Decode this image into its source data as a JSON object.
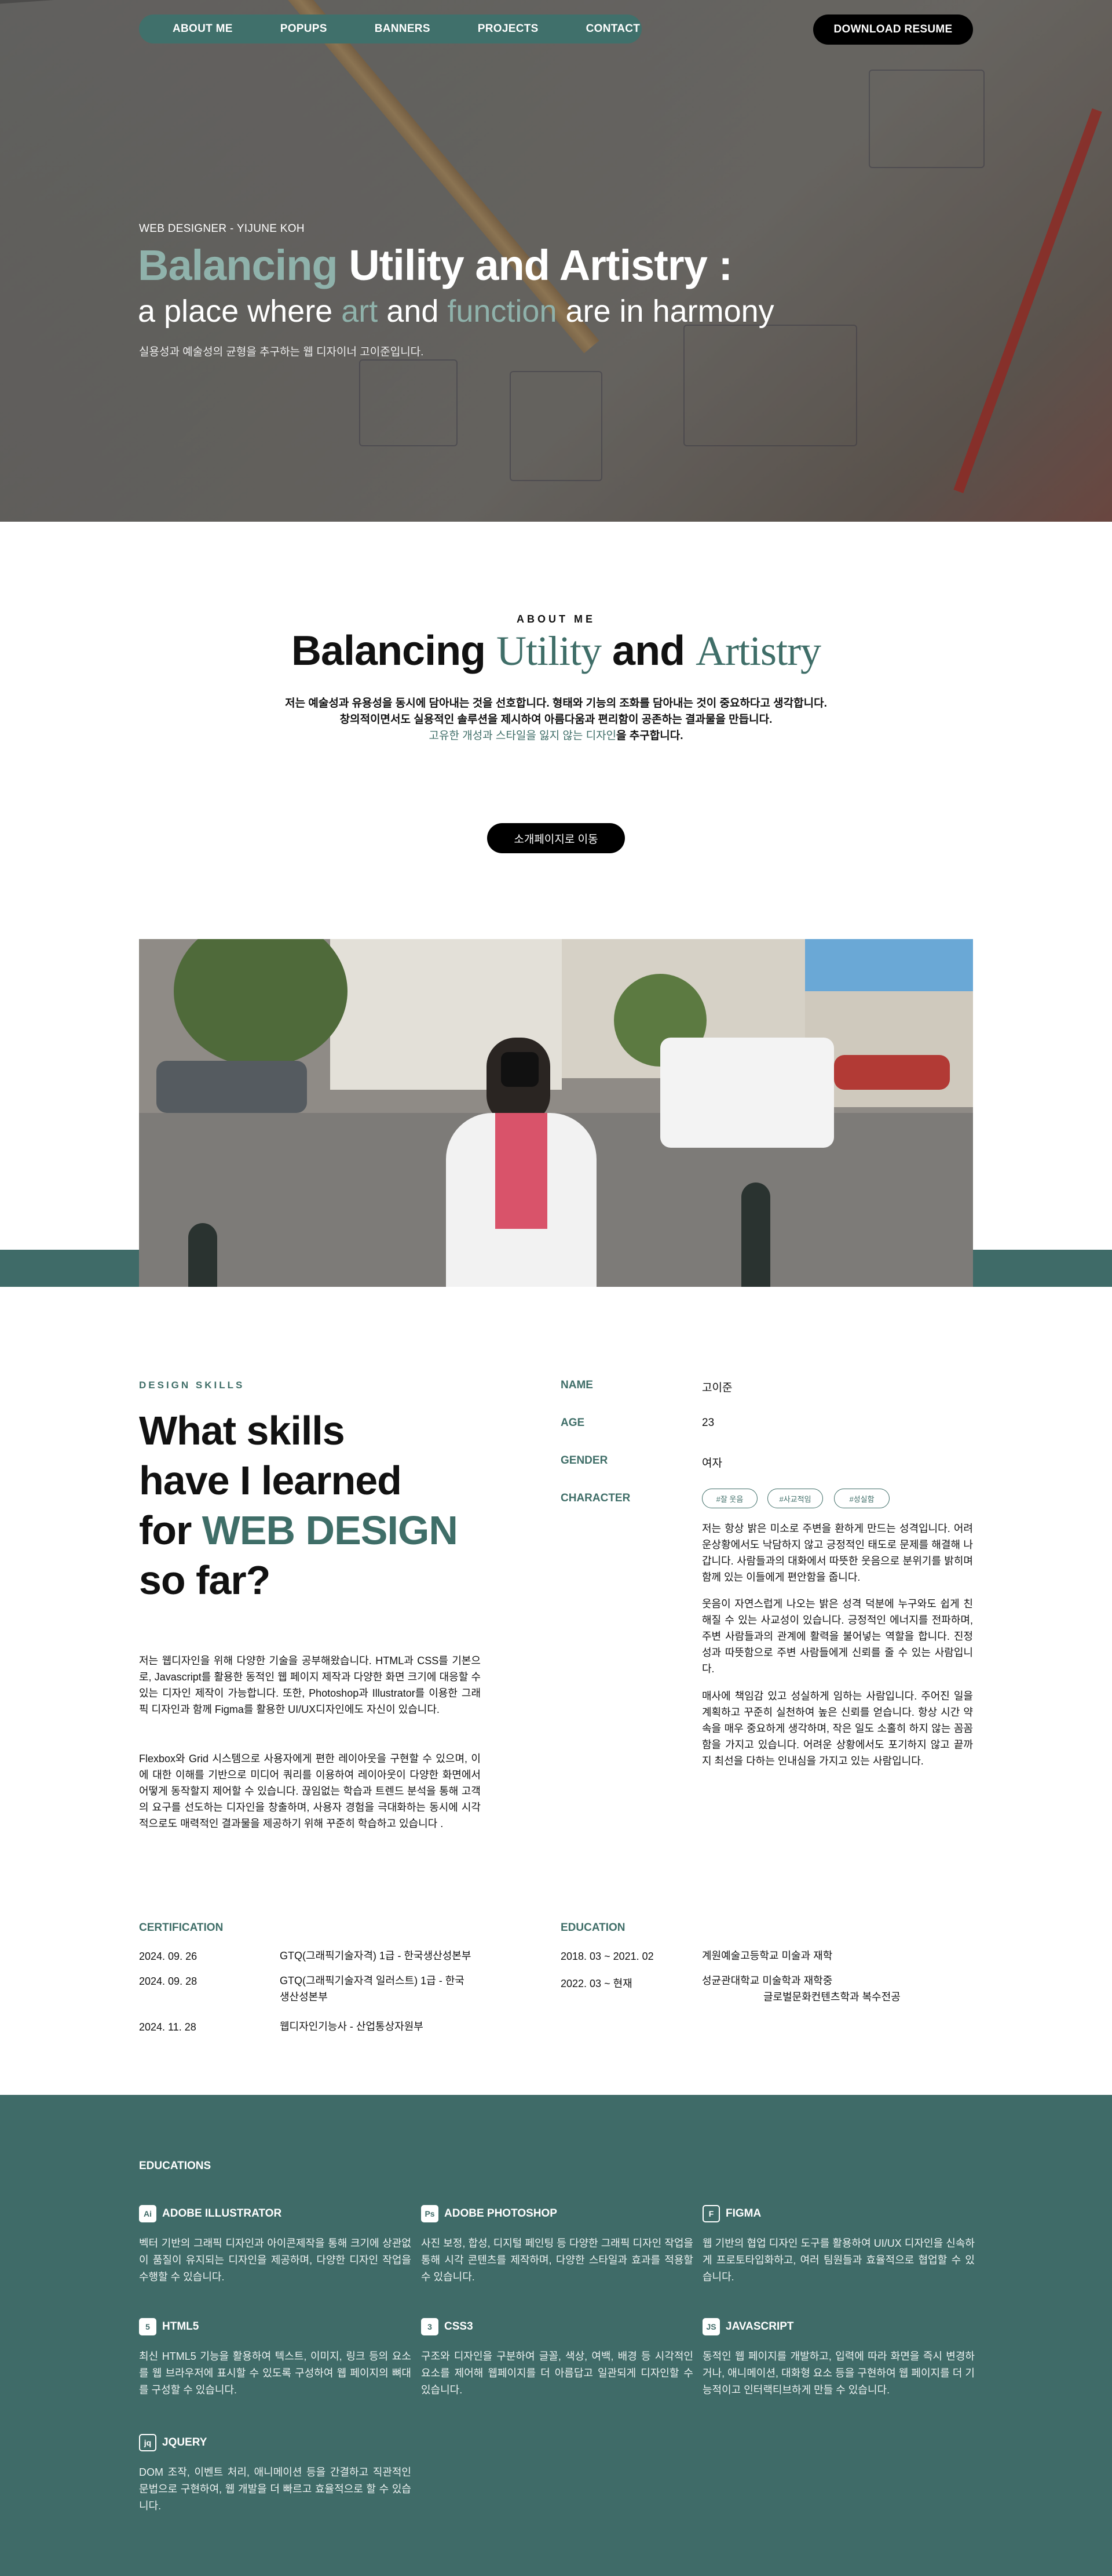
{
  "nav": {
    "items": [
      "ABOUT ME",
      "POPUPS",
      "BANNERS",
      "PROJECTS",
      "CONTACT"
    ],
    "download_label": "DOWNLOAD RESUME"
  },
  "hero": {
    "subtitle": "WEB DESIGNER - YIJUNE KOH",
    "title_accent": "Balancing",
    "title_rest": " Utility and Artistry :",
    "line_a": "a place where ",
    "line_art": "art",
    "line_b": " and ",
    "line_function": "function",
    "line_c": " are in harmony",
    "desc": "실용성과 예술성의 균형을 추구하는 웹 디자이너 고이준입니다."
  },
  "about": {
    "eyebrow": "ABOUT ME",
    "title_a": "Balancing ",
    "title_utility": "Utility",
    "title_b": " and ",
    "title_artistry": "Artistry",
    "p1": "저는 예술성과 유용성을 동시에 담아내는 것을 선호합니다. 형태와 기능의 조화를 담아내는 것이 중요하다고 생각합니다.",
    "p2": "창의적이면서도 실용적인 솔루션을 제시하여 아름다움과 편리함이 공존하는 결과물을 만듭니다.",
    "p3_accent": "고유한 개성과 스타일을 잃지 않는 디자인",
    "p3_rest": "을 추구합니다.",
    "button": "소개페이지로 이동"
  },
  "skills": {
    "eyebrow": "DESIGN SKILLS",
    "title_l1": "What skills",
    "title_l2": "have I learned",
    "title_l3a": "for ",
    "title_l3b": "WEB DESIGN",
    "title_l4": "so far?",
    "p1": "저는 웹디자인을 위해 다양한 기술을 공부해왔습니다. HTML과 CSS를 기본으로, Javascript를 활용한 동적인 웹 페이지 제작과 다양한 화면 크기에 대응할 수 있는 디자인 제작이 가능합니다. 또한, Photoshop과 Illustrator를 이용한 그래픽 디자인과 함께 Figma를 활용한 UI/UX디자인에도 자신이 있습니다.",
    "p2": "Flexbox와 Grid 시스템으로 사용자에게 편한 레이아웃을 구현할 수 있으며, 이에 대한 이해를 기반으로 미디어 쿼리를 이용하여 레이아웃이 다양한 화면에서 어떻게 동작할지 제어할 수 있습니다. 끊임없는 학습과 트렌드 분석을 통해 고객의 요구를 선도하는 디자인을 창출하며, 사용자 경험을 극대화하는 동시에 시각적으로도 매력적인 결과물을 제공하기 위해 꾸준히 학습하고 있습니다 ."
  },
  "profile": {
    "name_label": "NAME",
    "name": "고이준",
    "age_label": "AGE",
    "age": "23",
    "gender_label": "GENDER",
    "gender": "여자",
    "character_label": "CHARACTER",
    "tags": [
      "#잘 웃음",
      "#사교적임",
      "#성실함"
    ],
    "c1": "저는 항상 밝은 미소로 주변을 환하게 만드는 성격입니다. 어려운상황에서도 낙담하지 않고 긍정적인 태도로 문제를 해결해 나갑니다. 사람들과의 대화에서 따뜻한 웃음으로 분위기를 밝히며 함께 있는 이들에게 편안함을 줍니다.",
    "c2": "웃음이 자연스럽게 나오는 밝은 성격 덕분에 누구와도 쉽게 친해질 수 있는 사교성이 있습니다. 긍정적인 에너지를 전파하며, 주변 사람들과의 관계에 활력을 불어넣는 역할을 합니다. 진정성과 따뜻함으로 주변 사람들에게 신뢰를 줄 수 있는 사람입니다.",
    "c3": "매사에 책임감 있고 성실하게 임하는 사람입니다. 주어진 일을 계획하고 꾸준히 실천하여 높은 신뢰를 얻습니다. 항상 시간 약속을 매우 중요하게 생각하며, 작은 일도 소홀히 하지 않는 꼼꼼함을 가지고 있습니다. 어려운 상황에서도 포기하지 않고 끝까지 최선을 다하는 인내심을 가지고 있는 사람입니다."
  },
  "certification": {
    "heading": "CERTIFICATION",
    "rows": [
      {
        "date": "2024. 09. 26",
        "text": "GTQ(그래픽기술자격) 1급 - 한국생산성본부"
      },
      {
        "date": "2024. 09. 28",
        "text": "GTQ(그래픽기술자격 일러스트) 1급 - 한국생산성본부"
      },
      {
        "date": "2024. 11. 28",
        "text": "웹디자인기능사 - 산업통상자원부"
      }
    ]
  },
  "education": {
    "heading": "EDUCATION",
    "rows": [
      {
        "date": "2018. 03 ~ 2021. 02",
        "text": "계원예술고등학교 미술과 재학"
      },
      {
        "date": "2022. 03 ~ 현재",
        "text": "성균관대학교 미술학과 재학중",
        "text2": "글로벌문화컨텐츠학과 복수전공"
      }
    ]
  },
  "educations": {
    "heading": "EDUCATIONS",
    "tools": [
      {
        "icon": "Ai",
        "name": "ADOBE ILLUSTRATOR",
        "desc": "벡터 기반의 그래픽 디자인과 아이콘제작을 통해 크기에 상관없이 품질이 유지되는 디자인을 제공하며, 다양한 디자인 작업을 수행할 수 있습니다."
      },
      {
        "icon": "Ps",
        "name": "ADOBE PHOTOSHOP",
        "desc": "사진 보정, 합성, 디지털 페인팅 등 다양한 그래픽 디자인 작업을 통해 시각 콘텐츠를 제작하며, 다양한 스타일과 효과를 적용할 수 있습니다."
      },
      {
        "icon": "F",
        "name": "FIGMA",
        "desc": "웹 기반의 협업 디자인 도구를 활용하여 UI/UX 디자인을 신속하게 프로토타입화하고, 여러 팀원들과 효율적으로 협업할 수 있습니다."
      },
      {
        "icon": "5",
        "name": "HTML5",
        "desc": "최신 HTML5 기능을 활용하여 텍스트, 이미지, 링크 등의 요소를 웹 브라우저에 표시할 수 있도록 구성하여 웹 페이지의 뼈대를 구성할 수 있습니다."
      },
      {
        "icon": "3",
        "name": "CSS3",
        "desc": "구조와 디자인을 구분하여 글꼴, 색상, 여백, 배경 등 시각적인 요소를 제어해 웹페이지를 더 아름답고 일관되게 디자인할 수 있습니다."
      },
      {
        "icon": "JS",
        "name": "JAVASCRIPT",
        "desc": "동적인 웹 페이지를 개발하고, 입력에 따라 화면을 즉시 변경하거나, 애니메이션, 대화형 요소 등을 구현하여 웹 페이지를 더 기능적이고 인터랙티브하게 만들 수 있습니다."
      },
      {
        "icon": "jq",
        "name": "JQUERY",
        "desc": "DOM 조작, 이벤트 처리, 애니메이션 등을 간결하고 직관적인 문법으로 구현하여, 웹 개발을 더 빠르고 효율적으로 할 수 있습니다."
      }
    ]
  },
  "colors": {
    "accent": "#3f6e68",
    "muted_accent": "#8fb2ab",
    "dark": "#000000"
  }
}
